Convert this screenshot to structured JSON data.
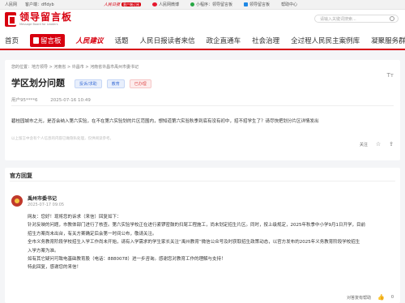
{
  "topbar": {
    "rmw": "人民网",
    "download": "客户端：dfldyb",
    "rmrb": "人民日报",
    "rmrb_badge": "客户端订阅",
    "weibo": "人民网微博",
    "miniapp": "小程序：领导留言板",
    "store": "领导留言板",
    "help": "帮助中心"
  },
  "header": {
    "logo_main": "领导留言板",
    "logo_sub": "Message Board for Leaders",
    "search_placeholder": "请输入关键词搜索..."
  },
  "nav": {
    "items": [
      "首页",
      "留言板",
      "人民建议",
      "话题",
      "人民日报读者来信",
      "政企直通车",
      "社会治理",
      "全过程人民民主案例库",
      "凝聚服务群众"
    ]
  },
  "message": {
    "breadcrumb": "您的位置：地方领导 > 河南省 > 许昌市 > 河南省许昌市禹州市委书记",
    "title": "学区划分问题",
    "tags": [
      "投诉/求助",
      "教育",
      "已办理"
    ],
    "user": "用户95****6",
    "time": "2025-07-16 10:49",
    "body": "碧桂园城市之光，是否会纳入第六实验，在不在第六实验划的片区范围内，想知道第六实验秋季到底有没有初中，招不招学生了？请尽快把划分片区详情发出",
    "notice": "以上留言中含有个人信息的内容已做隐私处理，仅供阅读参考。",
    "follow": "关注",
    "tt_icon": "Tт"
  },
  "reply": {
    "section_title": "官方回复",
    "org": "禹州市委书记",
    "date": "2025-07-17 09:05",
    "paragraphs": [
      "网友：您好！现将您的诉求（来信）回复如下：",
      "针对反映的问题，市教体部门进行了核查。第六实验学校正在进行紧锣密鼓的扫尾工程施工，尚未划定招生片区。同时，按上级规定，2025年秋季中小学9月1日开学，目前",
      "招生方案尚未出台，有关方案确定后会第一时间公布，敬请关注。",
      "全市义务教育阶段学校招生入学工作尚未开始，请有入学需求的学生家长关注“禹州教育”微信公众号及时获取招生政策动态，以官方发布的2025年义务教育阶段学校招生",
      "入学方案为准。",
      "如有其它疑问可致电基础教育股（电话：8880078）进一步咨询。感谢您对教育工作的理解与支持！",
      "特此回复，感谢您的来信！"
    ],
    "evaluate": "对答复有帮助",
    "like_count": "0"
  }
}
